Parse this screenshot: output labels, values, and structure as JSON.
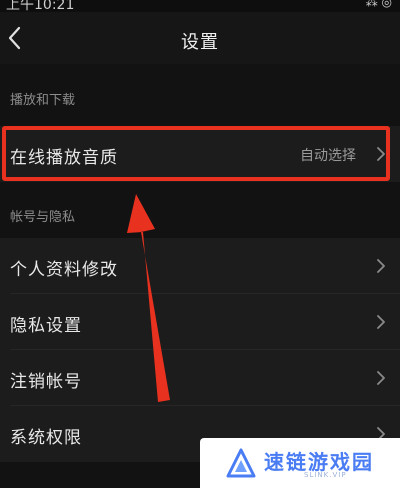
{
  "status_bar": {
    "time": "上午10:21",
    "right": "⁂ ◎"
  },
  "header": {
    "title": "设置"
  },
  "sections": [
    {
      "title": "播放和下载",
      "items": [
        {
          "label": "在线播放音质",
          "value": "自动选择"
        }
      ]
    },
    {
      "title": "帐号与隐私",
      "items": [
        {
          "label": "个人资料修改"
        },
        {
          "label": "隐私设置"
        },
        {
          "label": "注销帐号"
        },
        {
          "label": "系统权限"
        }
      ]
    }
  ],
  "watermark": {
    "text": "速链游戏园",
    "subtext": "SLINK.VIP"
  },
  "colors": {
    "background": "#121212",
    "row": "#1c1c1c",
    "highlight": "#e8321f",
    "watermark_text": "#4a7cf3"
  },
  "icons": {
    "back": "chevron-left-icon",
    "row_arrow": "chevron-right-icon",
    "watermark_logo": "triangle-logo-icon"
  }
}
